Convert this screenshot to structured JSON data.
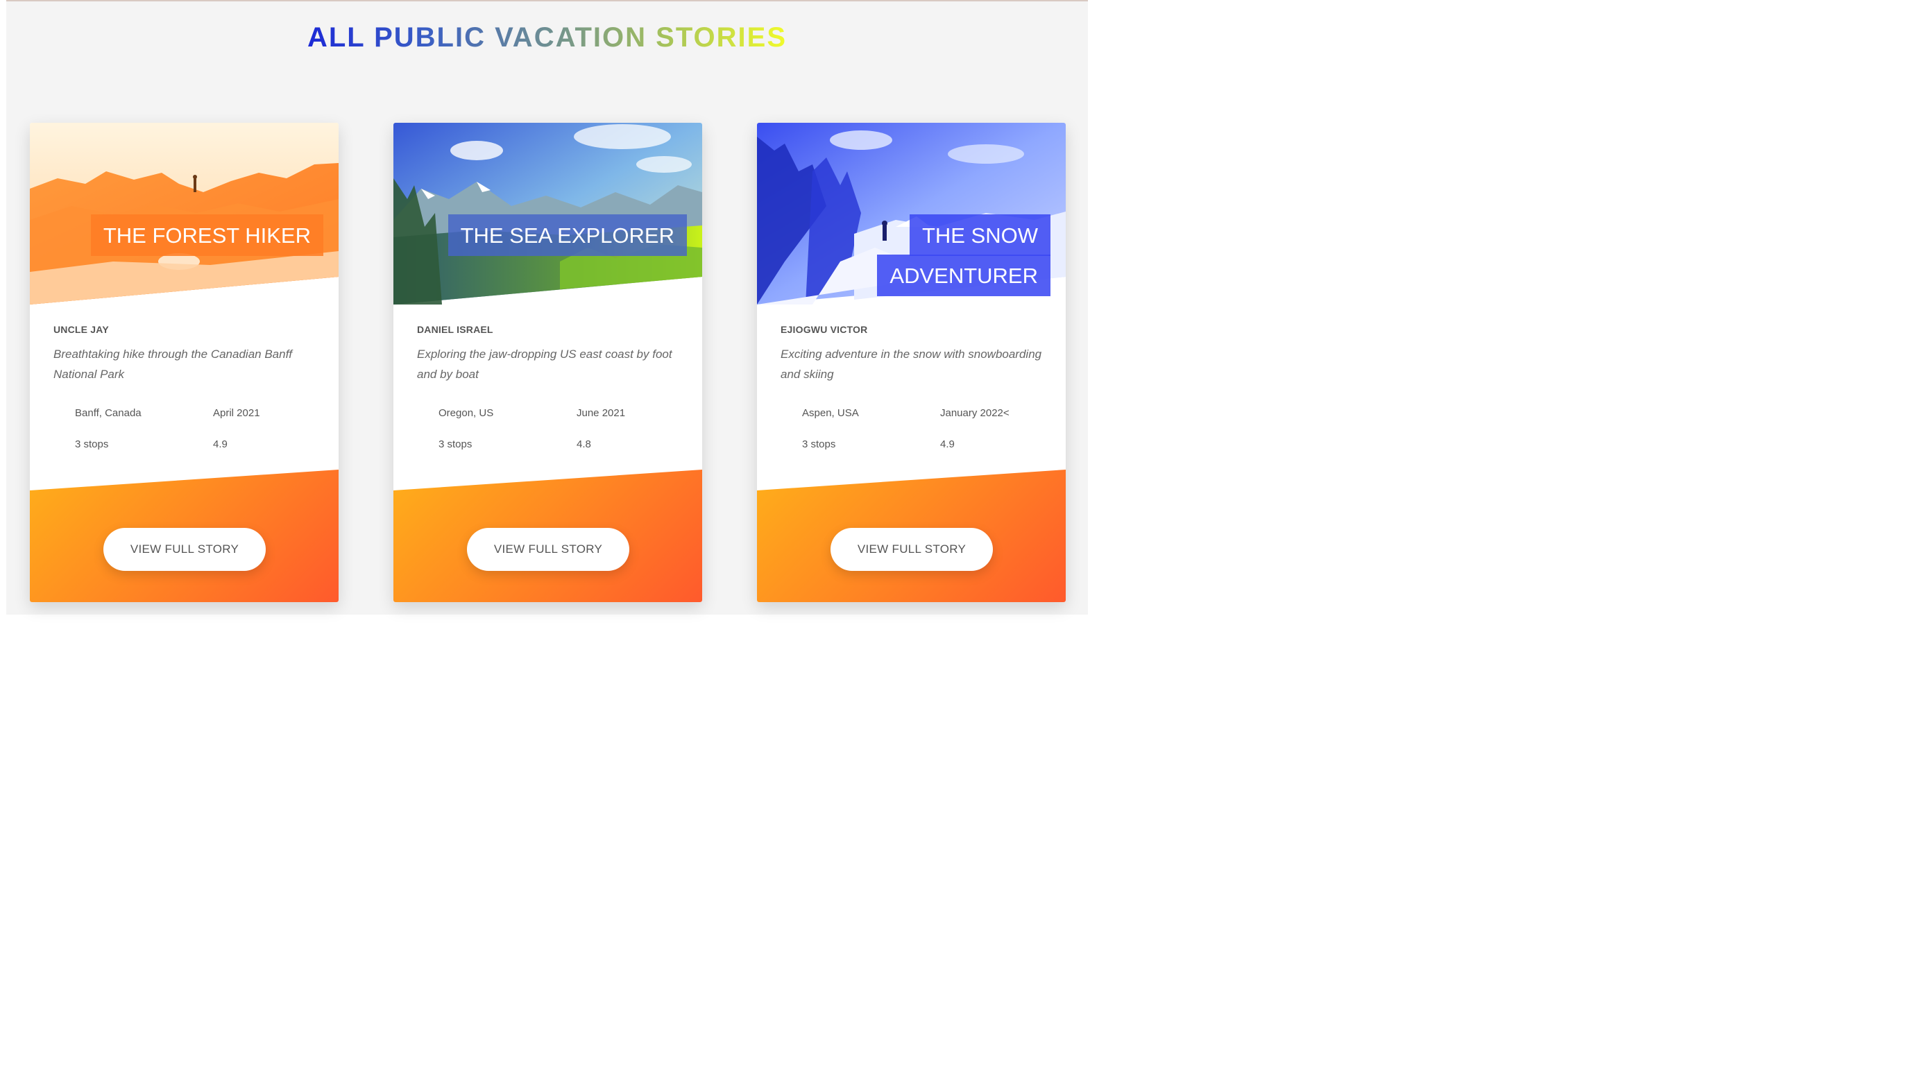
{
  "page": {
    "title": "ALL PUBLIC VACATION STORIES"
  },
  "colors": {
    "title_gradient_start": "#1c2ad6",
    "title_gradient_end": "#f1fb2a",
    "button_footer_orange": "#ff8a22",
    "card_label_orange": "#ff7d24",
    "card_label_green": "#4f6fbf",
    "card_label_blue": "#3b49f2"
  },
  "cards": [
    {
      "label_line1": "THE FOREST HIKER",
      "label_line2": "",
      "author": "UNCLE JAY",
      "description": "Breathtaking hike through the Canadian Banff National Park",
      "location": "Banff, Canada",
      "date": "April 2021",
      "stops": "3 stops",
      "rating": "4.9",
      "button": "VIEW FULL STORY"
    },
    {
      "label_line1": "THE SEA EXPLORER",
      "label_line2": "",
      "author": "DANIEL ISRAEL",
      "description": "Exploring the jaw-dropping US east coast by foot and by boat",
      "location": "Oregon, US",
      "date": "June 2021",
      "stops": "3 stops",
      "rating": "4.8",
      "button": "VIEW FULL STORY"
    },
    {
      "label_line1": "THE SNOW",
      "label_line2": "ADVENTURER",
      "author": "EJIOGWU VICTOR",
      "description": "Exciting adventure in the snow with snowboarding and skiing",
      "location": "Aspen, USA",
      "date": "January 2022<",
      "stops": "3 stops",
      "rating": "4.9",
      "button": "VIEW FULL STORY"
    }
  ]
}
